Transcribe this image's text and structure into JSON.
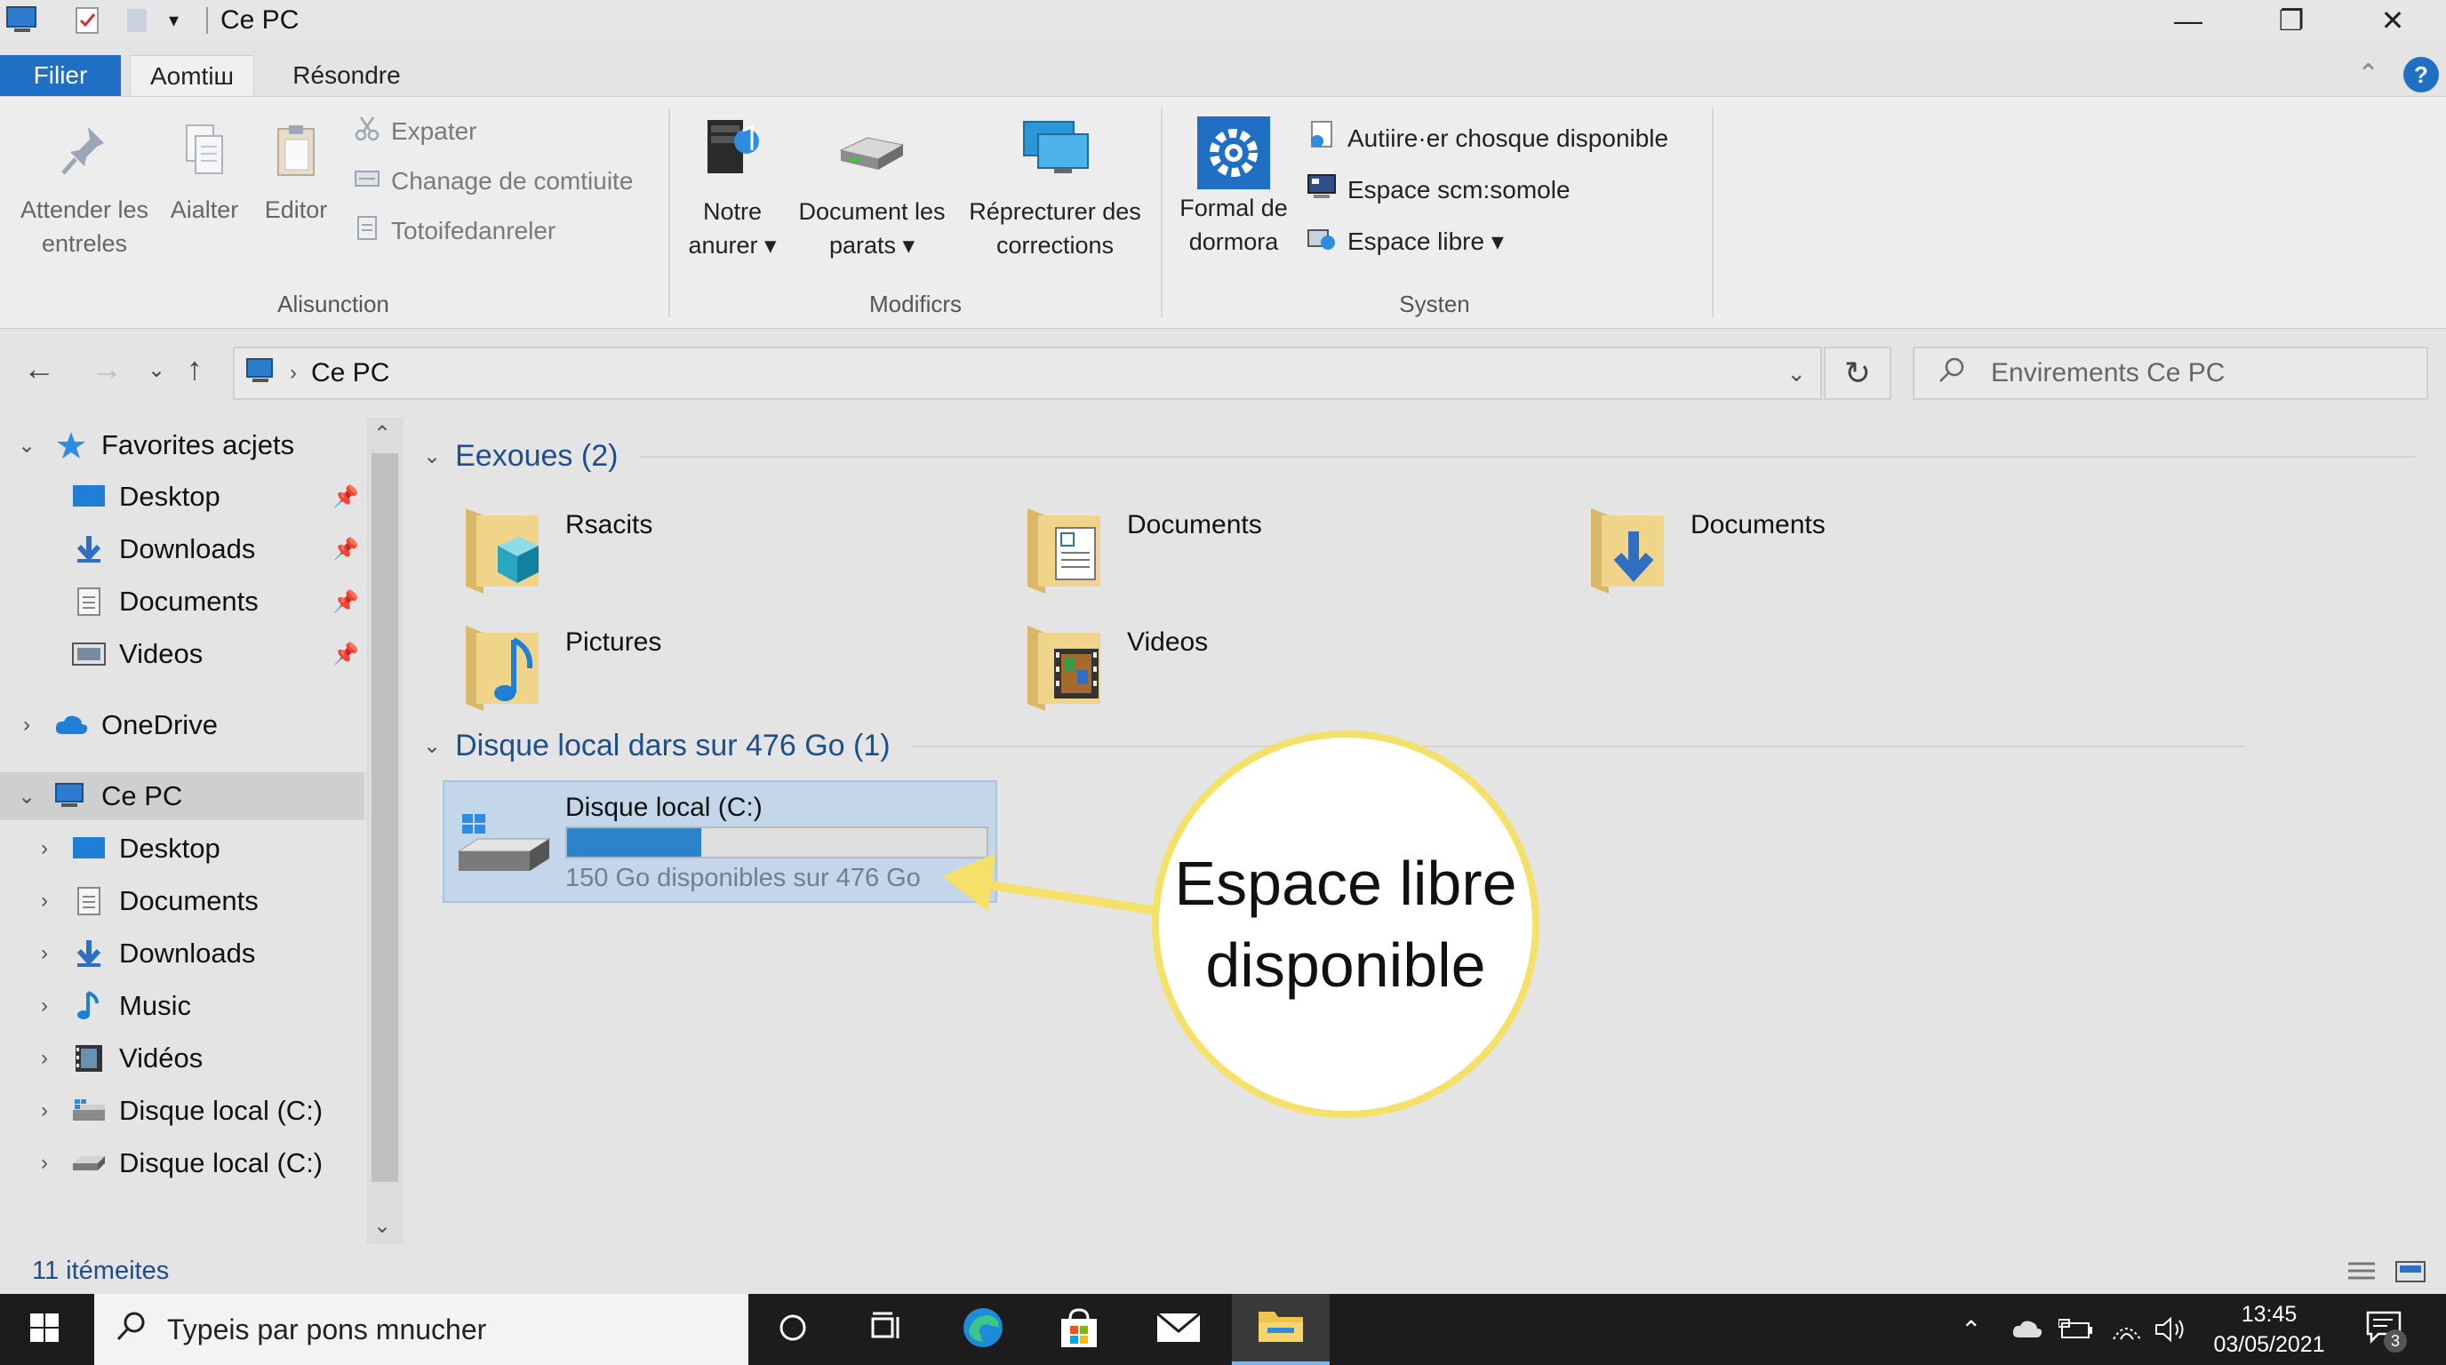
{
  "window": {
    "title": "Ce PC",
    "controls": {
      "minimize": "—",
      "maximize": "❐",
      "close": "✕"
    }
  },
  "ribbon": {
    "tabs": [
      {
        "label": "Filier",
        "active": false
      },
      {
        "label": "Aomtiш",
        "active": true
      },
      {
        "label": "Résondre",
        "active": false
      }
    ],
    "groups": {
      "g1": {
        "label": "Alisunction",
        "big": [
          {
            "label_1": "Attender les",
            "label_2": "entreles",
            "icon": "pin-icon"
          },
          {
            "label_1": "Aialter",
            "label_2": "",
            "icon": "copy-icon"
          },
          {
            "label_1": "Editor",
            "label_2": "",
            "icon": "paste-icon"
          }
        ],
        "small": [
          {
            "label": "Expater",
            "icon": "cut-icon"
          },
          {
            "label": "Chanage de comtiuite",
            "icon": "copy-path-icon"
          },
          {
            "label": "Totoifedanreler",
            "icon": "paste-shortcut-icon"
          }
        ]
      },
      "g2": {
        "label": "Modificrs",
        "big": [
          {
            "label_1": "Notre",
            "label_2": "anurer ▾",
            "icon": "media-icon"
          },
          {
            "label_1": "Document les",
            "label_2": "parats ▾",
            "icon": "map-drive-icon"
          },
          {
            "label_1": "Réprecturer des",
            "label_2": "corrections",
            "icon": "network-location-icon"
          }
        ]
      },
      "g3": {
        "label": "Systen",
        "big": [
          {
            "label_1": "Formal de",
            "label_2": "dormora",
            "icon": "settings-gear-icon"
          }
        ],
        "small": [
          {
            "label": "Autiire·er chosque disponible",
            "icon": "uninstall-icon"
          },
          {
            "label": "Espace scm:somole",
            "icon": "system-properties-icon"
          },
          {
            "label": "Espace libre ▾",
            "icon": "manage-icon"
          }
        ]
      }
    }
  },
  "address": {
    "path": "Ce PC",
    "search_placeholder": "Envirements Ce PC"
  },
  "nav_pane": {
    "items": [
      {
        "label": "Favorites acjets",
        "icon": "star-icon",
        "chevron": "⌄",
        "indent": 0,
        "pinned": false,
        "selected": false
      },
      {
        "label": "Desktop",
        "icon": "desktop-icon",
        "chevron": "",
        "indent": 1,
        "pinned": true,
        "selected": false
      },
      {
        "label": "Downloads",
        "icon": "download-icon",
        "chevron": "",
        "indent": 1,
        "pinned": true,
        "selected": false
      },
      {
        "label": "Documents",
        "icon": "documents-icon",
        "chevron": "",
        "indent": 1,
        "pinned": true,
        "selected": false
      },
      {
        "label": "Videos",
        "icon": "videos-icon",
        "chevron": "",
        "indent": 1,
        "pinned": true,
        "selected": false
      },
      {
        "label": "OneDrive",
        "icon": "cloud-icon",
        "chevron": "›",
        "indent": 0,
        "pinned": false,
        "selected": false
      },
      {
        "label": "Ce PC",
        "icon": "pc-icon",
        "chevron": "⌄",
        "indent": 0,
        "pinned": false,
        "selected": true
      },
      {
        "label": "Desktop",
        "icon": "desktop-icon",
        "chevron": "›",
        "indent": 1,
        "pinned": false,
        "selected": false
      },
      {
        "label": "Documents",
        "icon": "documents-icon",
        "chevron": "›",
        "indent": 1,
        "pinned": false,
        "selected": false
      },
      {
        "label": "Downloads",
        "icon": "download-icon",
        "chevron": "›",
        "indent": 1,
        "pinned": false,
        "selected": false
      },
      {
        "label": "Music",
        "icon": "music-icon",
        "chevron": "›",
        "indent": 1,
        "pinned": false,
        "selected": false
      },
      {
        "label": "Vidéos",
        "icon": "videos-icon",
        "chevron": "›",
        "indent": 1,
        "pinned": false,
        "selected": false
      },
      {
        "label": "Disque local (C:)",
        "icon": "windows-drive-icon",
        "chevron": "›",
        "indent": 1,
        "pinned": false,
        "selected": false
      },
      {
        "label": "Disque local (C:)",
        "icon": "drive-icon",
        "chevron": "›",
        "indent": 1,
        "pinned": false,
        "selected": false
      }
    ]
  },
  "content": {
    "folders_header": "Eexoues (2)",
    "folders": [
      {
        "label": "Rsacits",
        "icon": "3d-objects-folder-icon"
      },
      {
        "label": "Documents",
        "icon": "documents-folder-icon"
      },
      {
        "label": "Documents",
        "icon": "downloads-folder-icon"
      },
      {
        "label": "Pictures",
        "icon": "music-folder-icon"
      },
      {
        "label": "Videos",
        "icon": "videos-folder-icon"
      }
    ],
    "drives_header": "Disque local dars sur 476 Go (1)",
    "drive": {
      "name": "Disque local (C:)",
      "free_text": "150 Go disponibles sur 476 Go",
      "used_fraction": 0.32
    },
    "callout": {
      "line_1": "Espace libre",
      "line_2": "disponible"
    }
  },
  "status": {
    "items_text": "11 itémeites"
  },
  "taskbar": {
    "search_placeholder": "Typeis par pons mnucher",
    "time": "13:45",
    "date": "03/05/2021",
    "notification_count": "3"
  },
  "colors": {
    "accent": "#1f6fc4",
    "section_text": "#1f4e8c",
    "drive_fill": "#2b84c9",
    "callout_border": "#f5e16a"
  }
}
